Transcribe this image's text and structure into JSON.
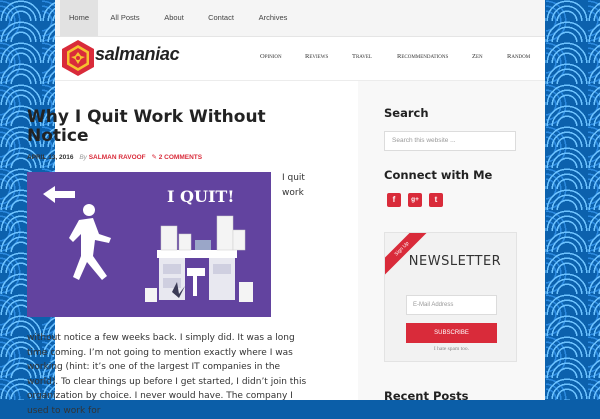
{
  "topnav": {
    "items": [
      {
        "label": "Home",
        "active": true
      },
      {
        "label": "All Posts"
      },
      {
        "label": "About"
      },
      {
        "label": "Contact"
      },
      {
        "label": "Archives"
      }
    ]
  },
  "header": {
    "logo_text": "salmaniac",
    "nav": [
      "Opinion",
      "Reviews",
      "Travel",
      "Recommendations",
      "Zen",
      "Random"
    ]
  },
  "post": {
    "title": "Why I Quit Work Without Notice",
    "date": "April 13, 2016",
    "by": "By",
    "author": "Salman Ravoof",
    "comments": "2 Comments",
    "image_caption": "I QUIT!",
    "float_text": "I quit work",
    "body": "without notice a few weeks back. I simply did. It was a long time coming. I’m not going to mention exactly where I was working (hint: it’s one of the largest IT companies in the world). To clear things up before I get started, I didn’t join this organization by choice. I never would have. The company I used to work for"
  },
  "sidebar": {
    "search_title": "Search",
    "search_placeholder": "Search this website ...",
    "connect_title": "Connect with Me",
    "social": [
      {
        "icon": "facebook-icon",
        "glyph": "f"
      },
      {
        "icon": "google-plus-icon",
        "glyph": "g+"
      },
      {
        "icon": "twitter-icon",
        "glyph": "t"
      }
    ],
    "newsletter": {
      "ribbon": "Sign Up",
      "title": "NEWSLETTER",
      "email_placeholder": "E-Mail Address",
      "button": "SUBSCRIBE",
      "note": "I hate spam too."
    },
    "recent_title": "Recent Posts"
  },
  "colors": {
    "accent": "#d92b3a",
    "image_bg": "#5b3d96",
    "background": "#0c61ad"
  }
}
